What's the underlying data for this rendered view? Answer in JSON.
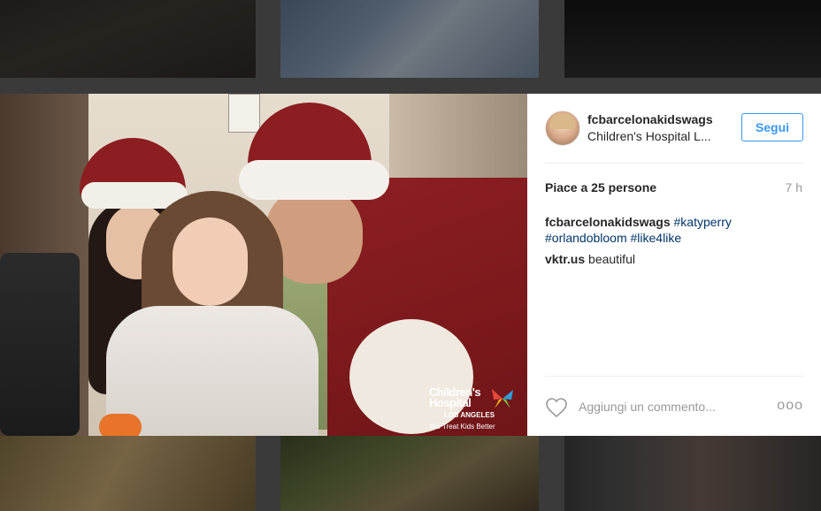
{
  "post": {
    "username": "fcbarcelonakidswags",
    "location": "Children's Hospital L...",
    "follow_label": "Segui",
    "likes": "Piace a 25 persone",
    "time_ago": "7 h",
    "caption": {
      "username": "fcbarcelonakidswags",
      "hashtags": [
        "#katyperry",
        "#orlandobloom",
        "#like4like"
      ]
    },
    "comments": [
      {
        "username": "vktr.us",
        "text": "beautiful"
      }
    ],
    "comment_placeholder": "Aggiungi un commento...",
    "more_label": "ooo"
  },
  "photo_logo": {
    "name_line1": "Children's",
    "name_line2": "Hospital",
    "city": "LOS ANGELES",
    "tagline": "We Treat Kids Better"
  },
  "colors": {
    "link": "#003569",
    "follow_accent": "#3897f0",
    "text": "#262626",
    "muted": "#999999"
  }
}
